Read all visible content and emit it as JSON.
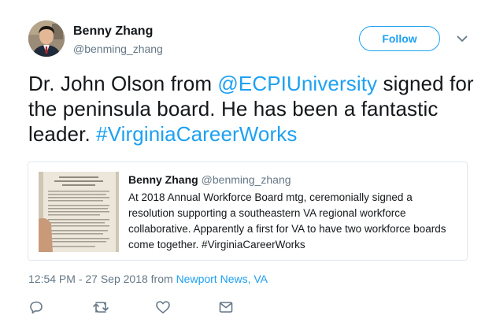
{
  "tweet": {
    "author": {
      "name": "Benny Zhang",
      "handle": "@benming_zhang"
    },
    "follow_label": "Follow",
    "text": {
      "part1": "Dr. John Olson from ",
      "mention": "@ECPIUniversity",
      "part2": " signed for the peninsula board. He has been a fantastic leader. ",
      "hashtag": "#VirginiaCareerWorks"
    },
    "quoted": {
      "name": "Benny Zhang",
      "handle": "@benming_zhang",
      "text": "At 2018 Annual Workforce Board mtg, ceremonially signed a resolution supporting a southeastern VA regional workforce collaborative. Apparently a first for VA to have two workforce boards come together. #VirginiaCareerWorks"
    },
    "meta": {
      "timestamp": "12:54 PM - 27 Sep 2018 from ",
      "location": "Newport News, VA"
    },
    "actions": {
      "icons": [
        "reply-icon",
        "retweet-icon",
        "like-icon",
        "direct-message-icon"
      ]
    },
    "colors": {
      "accent": "#1da1f2",
      "text": "#14171a",
      "secondary": "#657786",
      "border": "#e1e8ed"
    }
  }
}
